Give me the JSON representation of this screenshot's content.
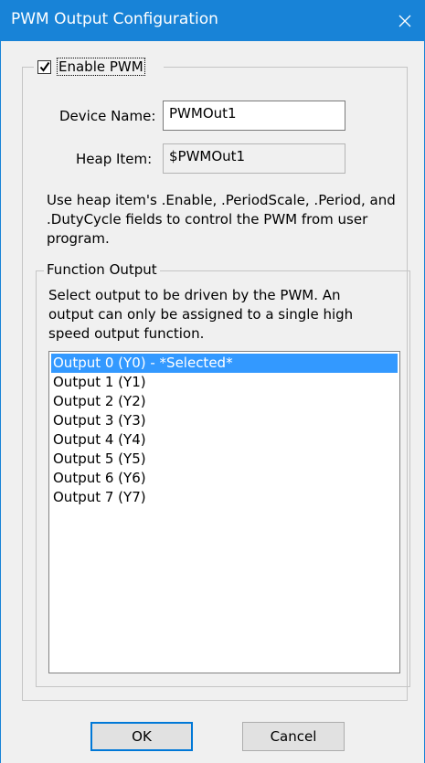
{
  "window": {
    "title": "PWM Output Configuration"
  },
  "enable": {
    "label": "Enable PWM",
    "checked": true
  },
  "device_name": {
    "label": "Device Name:",
    "value": "PWMOut1"
  },
  "heap_item": {
    "label": "Heap Item:",
    "value": "$PWMOut1"
  },
  "description": {
    "lines": [
      "Use heap item's .Enable, .PeriodScale, .Period, and",
      ".DutyCycle fields to control the PWM from user",
      "program."
    ]
  },
  "function_output": {
    "legend": "Function Output",
    "description_lines": [
      "Select output to be driven by the PWM. An",
      "output can only be assigned to a single high",
      "speed output function."
    ],
    "items": [
      "Output 0 (Y0) - *Selected*",
      "Output 1 (Y1)",
      "Output 2 (Y2)",
      "Output 3 (Y3)",
      "Output 4 (Y4)",
      "Output 5 (Y5)",
      "Output 6 (Y6)",
      "Output 7 (Y7)"
    ],
    "selected_index": 0
  },
  "buttons": {
    "ok": "OK",
    "cancel": "Cancel"
  },
  "colors": {
    "titlebar": "#1883d7",
    "selection": "#3399ff",
    "dialog_bg": "#f0f0f0"
  }
}
